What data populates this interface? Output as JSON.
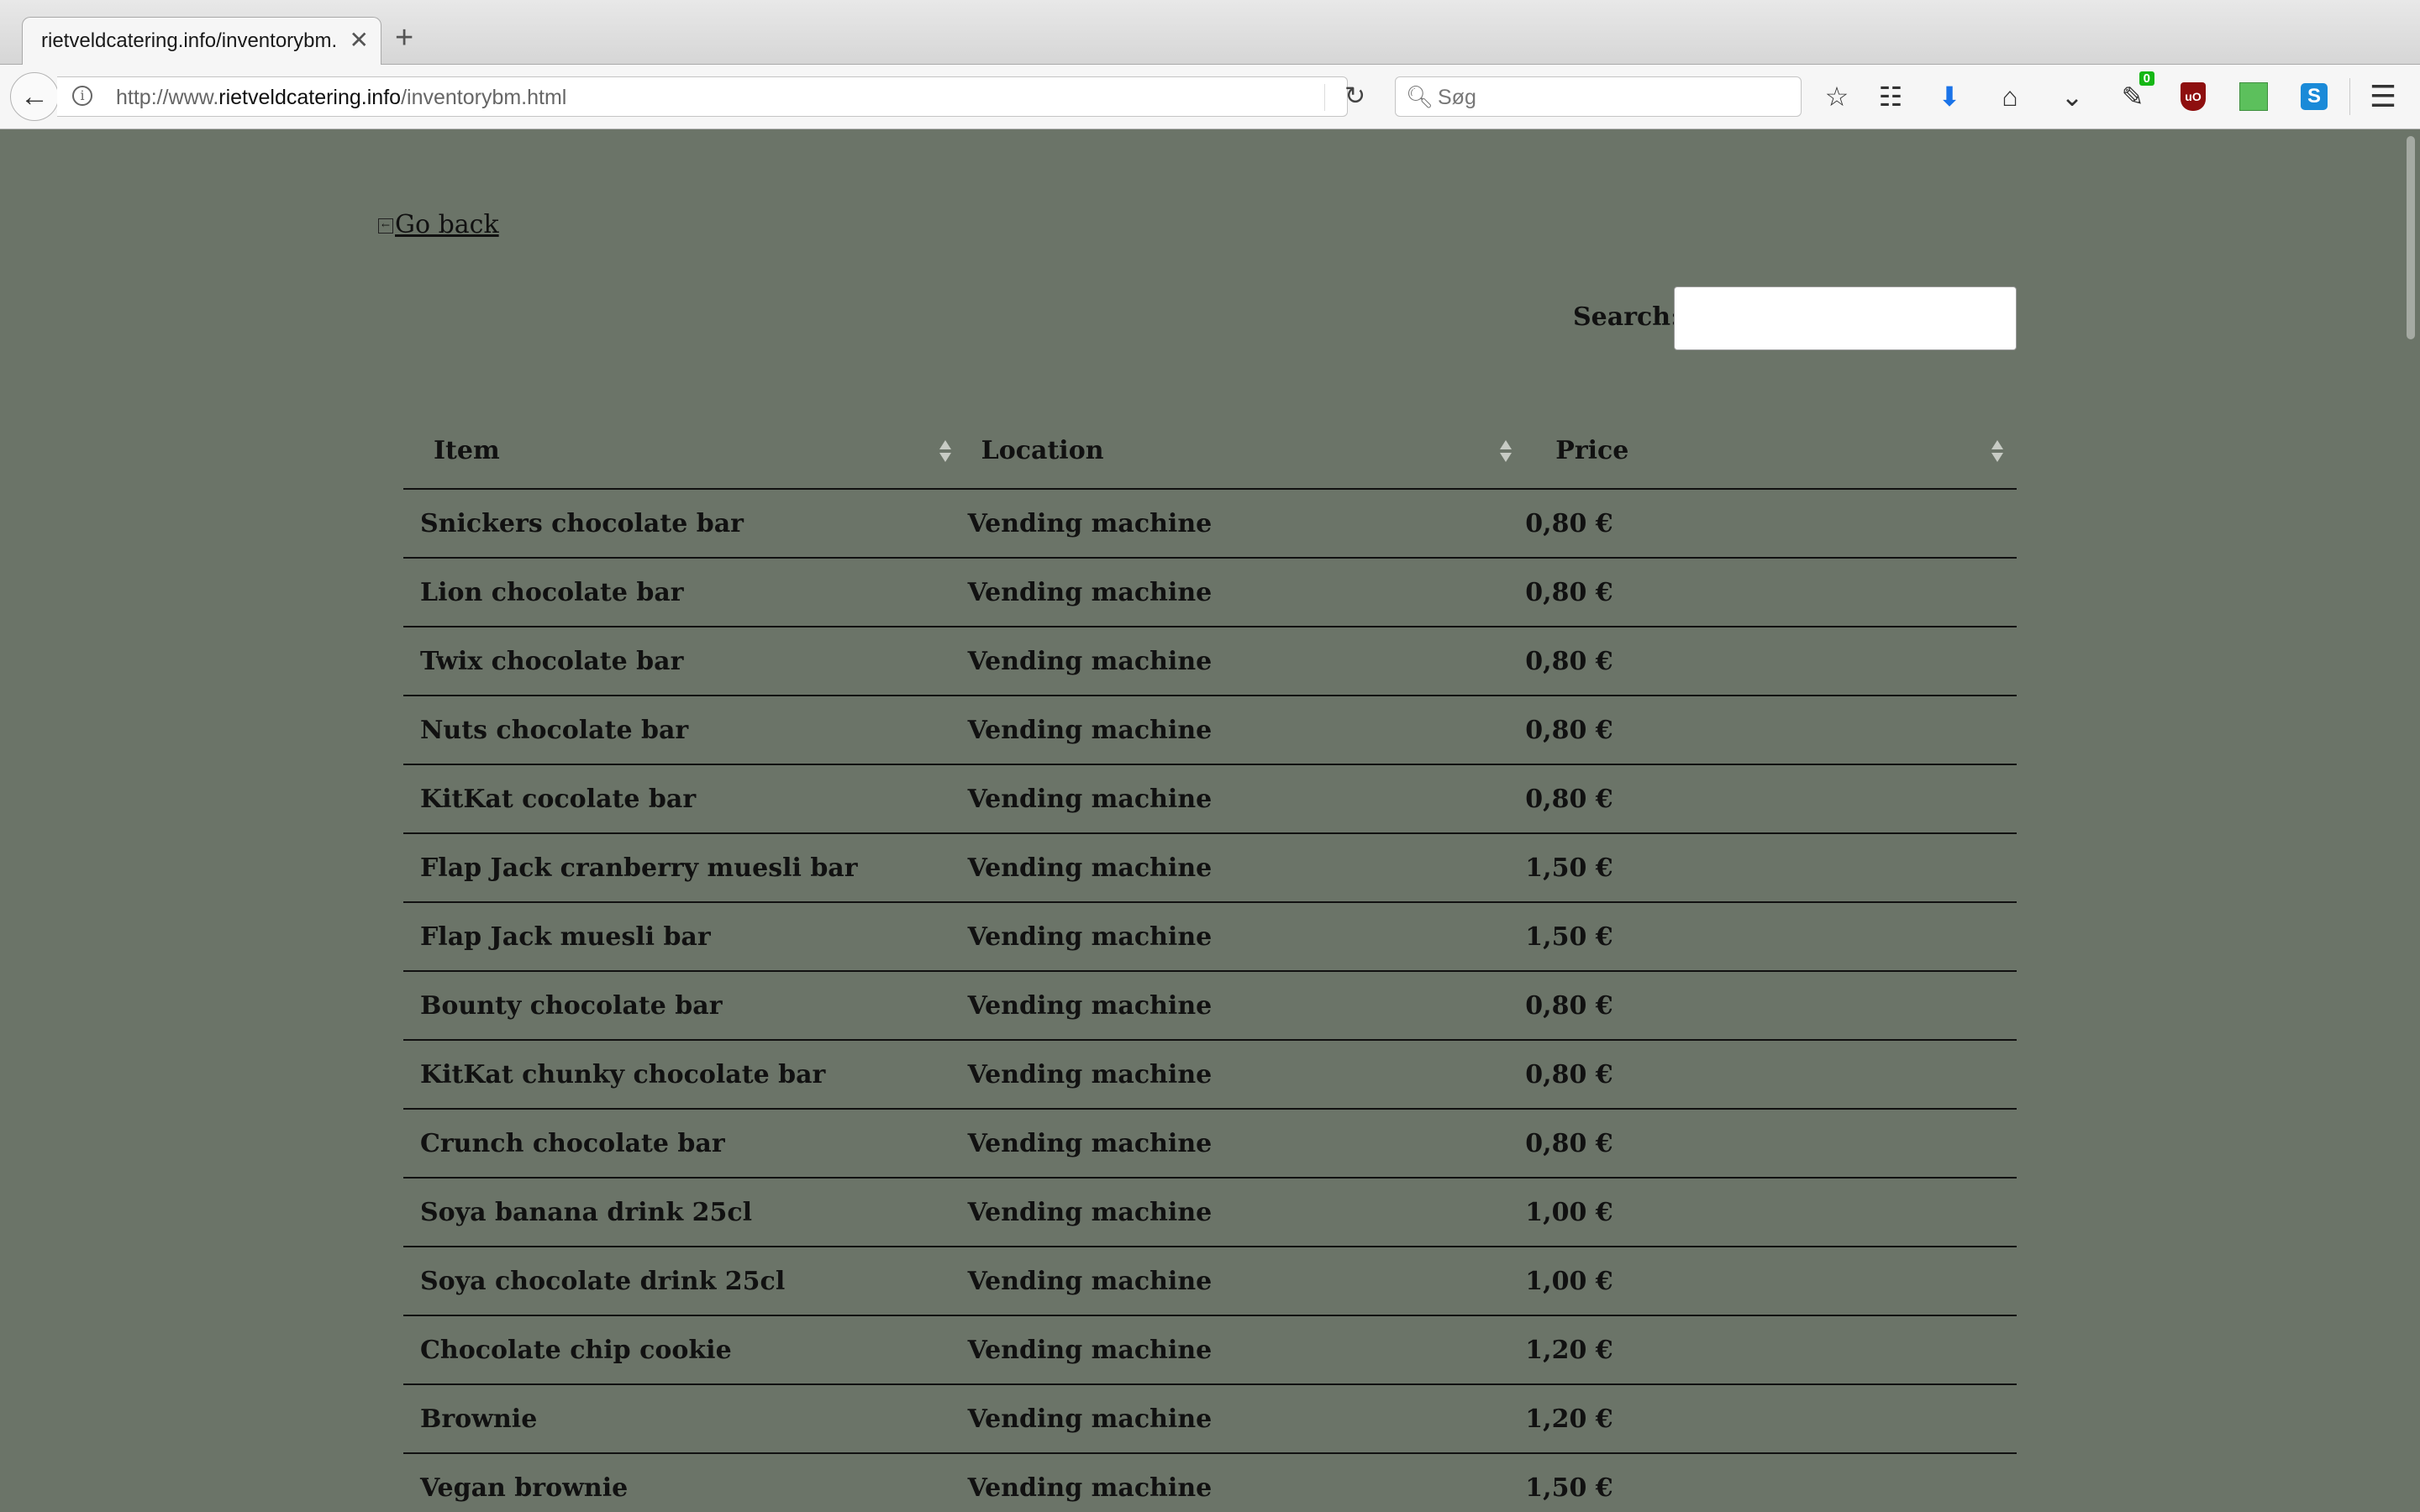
{
  "browser": {
    "tab_title": "rietveldcatering.info/inventorybm.",
    "tab_close": "✕",
    "new_tab": "+",
    "url_prefix": "http://www.",
    "url_host": "rietveldcatering.info",
    "url_path": "/inventorybm.html",
    "search_placeholder": "Søg",
    "ext_badge": "0",
    "ublock_label": "uO",
    "skype_label": "S"
  },
  "page": {
    "go_back": "Go back",
    "search_label": "Search:",
    "search_value": ""
  },
  "table": {
    "headers": [
      "Item",
      "Location",
      "Price"
    ],
    "rows": [
      [
        "Snickers chocolate bar",
        "Vending machine",
        "0,80 €"
      ],
      [
        "Lion chocolate bar",
        "Vending machine",
        "0,80 €"
      ],
      [
        "Twix chocolate bar",
        "Vending machine",
        "0,80 €"
      ],
      [
        "Nuts chocolate bar",
        "Vending machine",
        "0,80 €"
      ],
      [
        "KitKat cocolate bar",
        "Vending machine",
        "0,80 €"
      ],
      [
        "Flap Jack cranberry muesli bar",
        "Vending machine",
        "1,50 €"
      ],
      [
        "Flap Jack muesli bar",
        "Vending machine",
        "1,50 €"
      ],
      [
        "Bounty chocolate bar",
        "Vending machine",
        "0,80 €"
      ],
      [
        "KitKat chunky chocolate bar",
        "Vending machine",
        "0,80 €"
      ],
      [
        "Crunch chocolate bar",
        "Vending machine",
        "0,80 €"
      ],
      [
        "Soya banana drink 25cl",
        "Vending machine",
        "1,00 €"
      ],
      [
        "Soya chocolate drink 25cl",
        "Vending machine",
        "1,00 €"
      ],
      [
        "Chocolate chip cookie",
        "Vending machine",
        "1,20 €"
      ],
      [
        "Brownie",
        "Vending machine",
        "1,20 €"
      ],
      [
        "Vegan brownie",
        "Vending machine",
        "1,50 €"
      ]
    ]
  },
  "colors": {
    "page_background": "#6b7468",
    "download_icon": "#1a73e8",
    "badge_green": "#15b715",
    "ublock_red": "#8e0f0f"
  }
}
